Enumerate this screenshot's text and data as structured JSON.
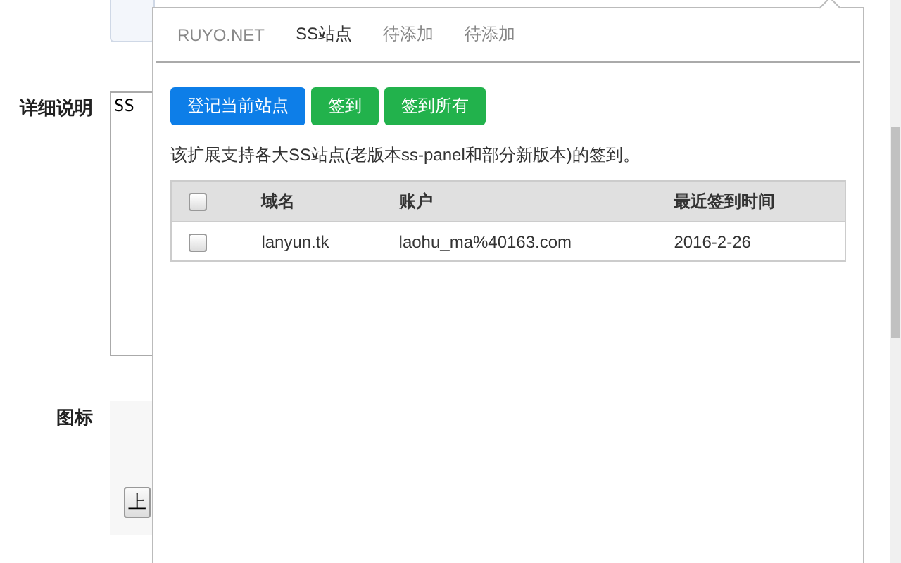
{
  "page": {
    "fields": [
      {
        "label": "详细说明",
        "kind": "textarea",
        "value": "SS"
      },
      {
        "label": "图标",
        "kind": "upload",
        "button": "上"
      }
    ]
  },
  "popup": {
    "tabs": [
      {
        "label": "RUYO.NET",
        "selected": false
      },
      {
        "label": "SS站点",
        "selected": true
      },
      {
        "label": "待添加",
        "selected": false
      },
      {
        "label": "待添加",
        "selected": false
      }
    ],
    "buttons": [
      {
        "label": "登记当前站点",
        "kind": "primary"
      },
      {
        "label": "签到",
        "kind": "success"
      },
      {
        "label": "签到所有",
        "kind": "success"
      }
    ],
    "description": "该扩展支持各大SS站点(老版本ss-panel和部分新版本)的签到。",
    "table": {
      "header_checked": false,
      "columns": [
        "域名",
        "账户",
        "最近签到时间"
      ],
      "rows": [
        {
          "checked": false,
          "cells": [
            "lanyun.tk",
            "laohu_ma%40163.com",
            "2016-2-26"
          ]
        }
      ]
    }
  }
}
